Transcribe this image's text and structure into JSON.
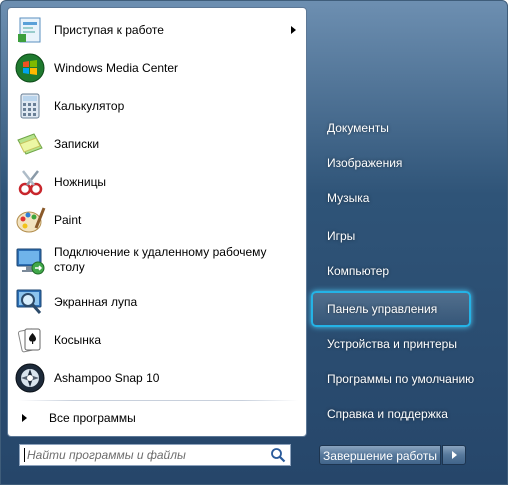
{
  "programs": [
    {
      "label": "Приступая к работе",
      "icon": "getting-started-icon",
      "submenu": true
    },
    {
      "label": "Windows Media Center",
      "icon": "media-center-icon"
    },
    {
      "label": "Калькулятор",
      "icon": "calculator-icon"
    },
    {
      "label": "Записки",
      "icon": "sticky-notes-icon"
    },
    {
      "label": "Ножницы",
      "icon": "snipping-tool-icon"
    },
    {
      "label": "Paint",
      "icon": "paint-icon"
    },
    {
      "label": "Подключение к удаленному рабочему столу",
      "line1": "Подключение к удаленному рабочему",
      "line2": "столу",
      "icon": "remote-desktop-icon"
    },
    {
      "label": "Экранная лупа",
      "icon": "magnifier-icon"
    },
    {
      "label": "Косынка",
      "icon": "solitaire-icon"
    },
    {
      "label": "Ashampoo Snap 10",
      "icon": "ashampoo-snap-icon"
    }
  ],
  "all_programs": "Все программы",
  "search": {
    "placeholder": "Найти программы и файлы"
  },
  "right_items": [
    "Документы",
    "Изображения",
    "Музыка",
    "Игры",
    "Компьютер",
    "Панель управления",
    "Устройства и принтеры",
    "Программы по умолчанию",
    "Справка и поддержка"
  ],
  "highlighted_item": "Панель управления",
  "shutdown_label": "Завершение работы",
  "colors": {
    "highlight_border": "#24b3e6",
    "panel_dark": "#26466a"
  }
}
